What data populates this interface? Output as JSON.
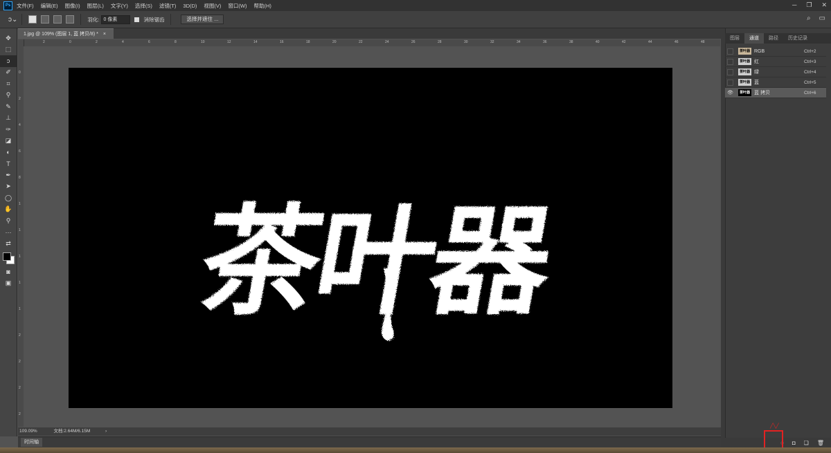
{
  "app": {
    "logo": "Ps"
  },
  "menu": [
    "文件(F)",
    "编辑(E)",
    "图像(I)",
    "图层(L)",
    "文字(Y)",
    "选择(S)",
    "滤镜(T)",
    "3D(D)",
    "视图(V)",
    "窗口(W)",
    "帮助(H)"
  ],
  "window_controls": {
    "minimize": "─",
    "restore": "❐",
    "close": "✕"
  },
  "options": {
    "feather_label": "羽化:",
    "feather_value": "0 像素",
    "antialias_label": "消除锯齿",
    "select_mask_button": "选择并遮住 ..."
  },
  "document": {
    "tab_title": "1.jpg @ 109% (图层 1, 蓝 拷贝/8) *",
    "zoom": "109.09%",
    "doc_info": "文档:2.64M/6.15M",
    "artwork_text": "茶叶器"
  },
  "ruler": {
    "h_ticks": [
      "2",
      "0",
      "2",
      "4",
      "6",
      "8",
      "10",
      "12",
      "14",
      "16",
      "18",
      "20",
      "22",
      "24",
      "26",
      "28",
      "30",
      "32",
      "34",
      "36",
      "38",
      "40",
      "42",
      "44",
      "46",
      "48"
    ],
    "v_ticks": [
      "0",
      "2",
      "4",
      "6",
      "8",
      "1",
      "1",
      "1",
      "1",
      "1",
      "2",
      "2",
      "2",
      "2"
    ]
  },
  "timeline": {
    "label": "时间轴"
  },
  "panel": {
    "tabs": [
      "图层",
      "通道",
      "路径",
      "历史记录"
    ],
    "active_tab": 1,
    "channels": [
      {
        "name": "RGB",
        "shortcut": "Ctrl+2",
        "visible": false
      },
      {
        "name": "红",
        "shortcut": "Ctrl+3",
        "visible": false
      },
      {
        "name": "绿",
        "shortcut": "Ctrl+4",
        "visible": false
      },
      {
        "name": "蓝",
        "shortcut": "Ctrl+5",
        "visible": false
      },
      {
        "name": "蓝 拷贝",
        "shortcut": "Ctrl+6",
        "visible": true
      }
    ]
  },
  "colors": {
    "highlight": "#e32222",
    "canvas_bg": "#000000",
    "artwork": "#ffffff"
  }
}
